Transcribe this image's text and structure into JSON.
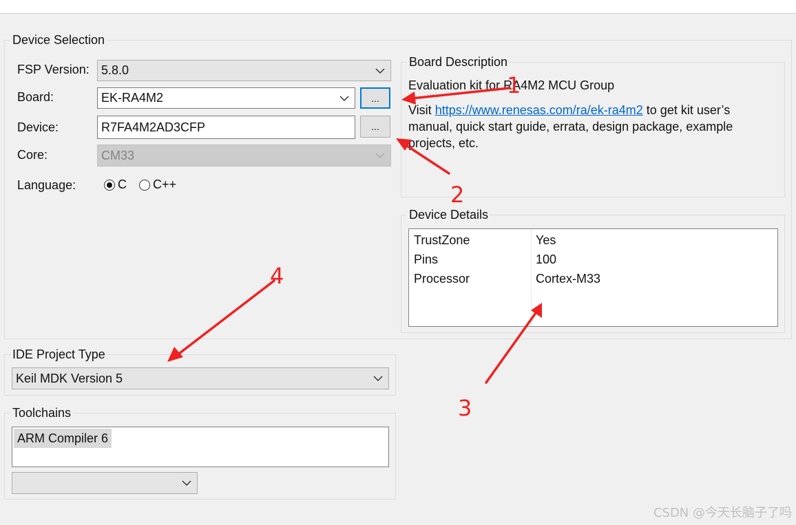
{
  "device_selection": {
    "title": "Device Selection",
    "fsp_label": "FSP Version:",
    "fsp_value": "5.8.0",
    "board_label": "Board:",
    "board_value": "EK-RA4M2",
    "board_browse": "...",
    "device_label": "Device:",
    "device_value": "R7FA4M2AD3CFP",
    "device_browse": "...",
    "core_label": "Core:",
    "core_value": "CM33",
    "language_label": "Language:",
    "language_options": [
      "C",
      "C++"
    ],
    "language_selected": "C"
  },
  "board_description": {
    "title": "Board Description",
    "line1": "Evaluation kit for RA4M2 MCU Group",
    "visit_prefix": "Visit ",
    "link": "https://www.renesas.com/ra/ek-ra4m2",
    "suffix": " to get kit user’s manual, quick start guide, errata, design package, example projects, etc."
  },
  "device_details": {
    "title": "Device Details",
    "rows": [
      {
        "key": "TrustZone",
        "value": "Yes"
      },
      {
        "key": "Pins",
        "value": "100"
      },
      {
        "key": "Processor",
        "value": "Cortex-M33"
      }
    ]
  },
  "ide_project": {
    "title": "IDE Project Type",
    "value": "Keil MDK Version 5"
  },
  "toolchains": {
    "title": "Toolchains",
    "selected": "ARM Compiler 6",
    "dropdown_value": ""
  },
  "annotations": [
    "1",
    "2",
    "3",
    "4"
  ],
  "annotation_color": "#ee2222",
  "link_color": "#0066cc",
  "watermark": "CSDN @今天长脑子了吗"
}
